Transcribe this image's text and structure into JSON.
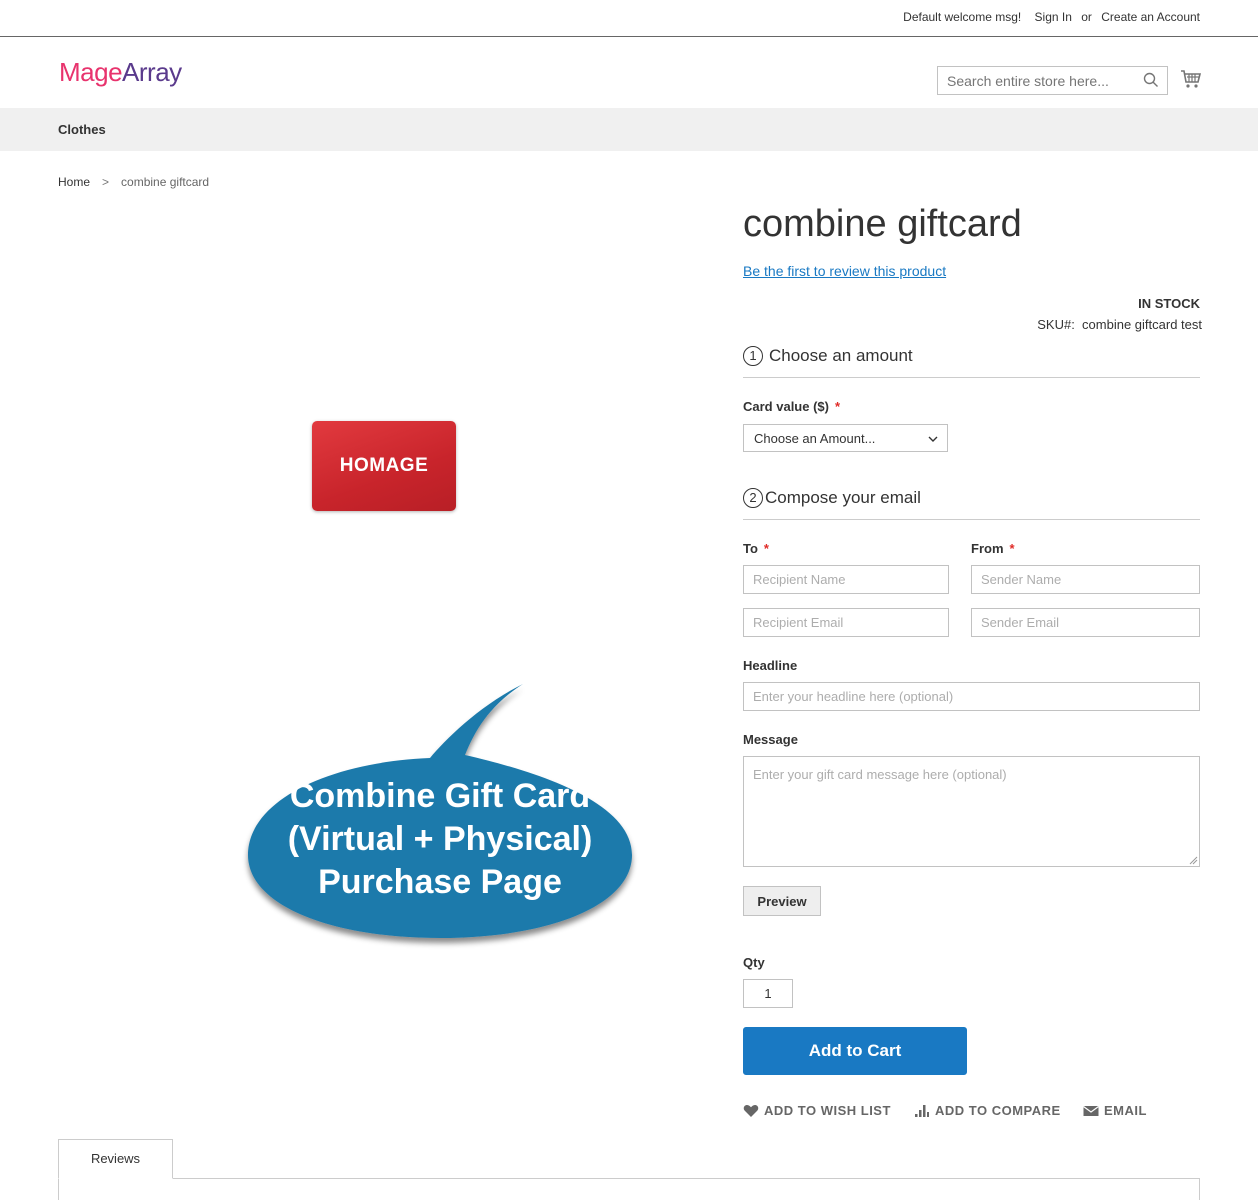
{
  "top_links": {
    "welcome": "Default welcome msg!",
    "sign_in": "Sign In",
    "or": "or",
    "create_account": "Create an Account"
  },
  "header": {
    "logo_part1": "Mage",
    "logo_part2": "Array",
    "search_placeholder": "Search entire store here..."
  },
  "nav": {
    "items": [
      "Clothes"
    ]
  },
  "breadcrumb": {
    "home": "Home",
    "separator": ">",
    "current": "combine giftcard"
  },
  "giftcard_image": {
    "text": "HOMAGE"
  },
  "bubble": {
    "line1": "Combine Gift Card",
    "line2": "(Virtual + Physical)",
    "line3": "Purchase Page"
  },
  "product": {
    "title": "combine giftcard",
    "review_link": "Be the first to review this product",
    "stock": "IN STOCK",
    "sku_label": "SKU#:",
    "sku_value": "combine giftcard test"
  },
  "step1": {
    "num": "1",
    "title": "Choose an amount"
  },
  "card_value": {
    "label": "Card value ($)",
    "required": "*",
    "selected": "Choose an Amount..."
  },
  "step2": {
    "num": "2",
    "title": "Compose your email"
  },
  "to": {
    "label": "To",
    "required": "*",
    "name_placeholder": "Recipient Name",
    "email_placeholder": "Recipient Email"
  },
  "from": {
    "label": "From",
    "required": "*",
    "name_placeholder": "Sender Name",
    "email_placeholder": "Sender Email"
  },
  "headline": {
    "label": "Headline",
    "placeholder": "Enter your headline here (optional)"
  },
  "message": {
    "label": "Message",
    "placeholder": "Enter your gift card message here (optional)"
  },
  "preview_button": "Preview",
  "qty": {
    "label": "Qty",
    "value": "1"
  },
  "add_to_cart": "Add to Cart",
  "actions": {
    "wishlist": "ADD TO WISH LIST",
    "compare": "ADD TO COMPARE",
    "email": "EMAIL"
  },
  "tabs": {
    "reviews": "Reviews"
  },
  "colors": {
    "brand_pink": "#e8336d",
    "brand_purple": "#5a3a8c",
    "primary_blue": "#1979c3",
    "bubble_blue": "#1e7aab",
    "card_red": "#c8242b"
  }
}
